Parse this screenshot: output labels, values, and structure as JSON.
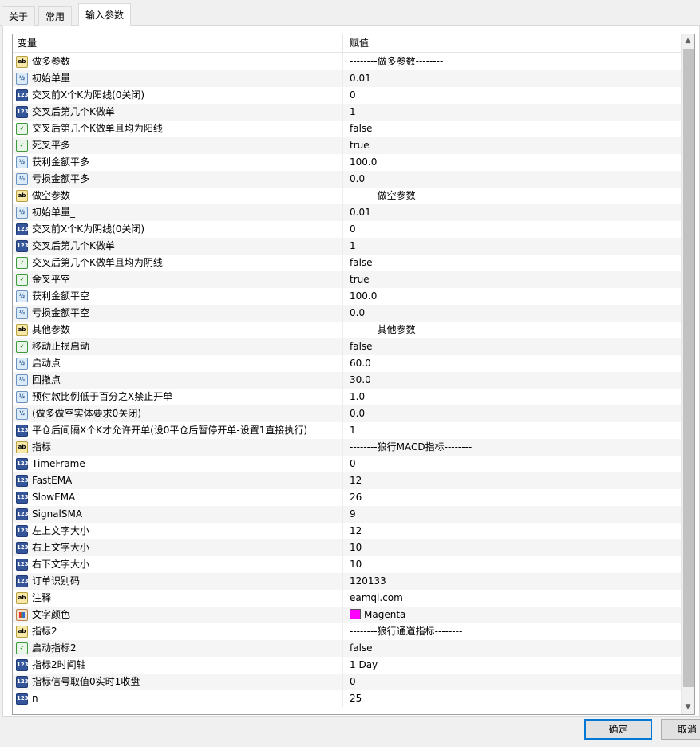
{
  "tabs": [
    {
      "label": "关于",
      "active": false
    },
    {
      "label": "常用",
      "active": false
    },
    {
      "label": "输入参数",
      "active": true
    }
  ],
  "columns": {
    "variable": "变量",
    "value": "赋值"
  },
  "rows": [
    {
      "type": "str",
      "icon": "ab",
      "name": "做多参数",
      "value": "--------做多参数--------"
    },
    {
      "type": "dbl",
      "icon": "½",
      "name": "初始单量",
      "value": "0.01"
    },
    {
      "type": "int",
      "icon": "123",
      "name": "交叉前X个K为阳线(0关闭)",
      "value": "0"
    },
    {
      "type": "int",
      "icon": "123",
      "name": "交叉后第几个K做单",
      "value": "1"
    },
    {
      "type": "bool",
      "icon": "✓",
      "name": "交叉后第几个K做单且均为阳线",
      "value": "false"
    },
    {
      "type": "bool",
      "icon": "✓",
      "name": "死叉平多",
      "value": "true"
    },
    {
      "type": "dbl",
      "icon": "½",
      "name": "获利金额平多",
      "value": "100.0"
    },
    {
      "type": "dbl",
      "icon": "½",
      "name": "亏损金额平多",
      "value": "0.0"
    },
    {
      "type": "str",
      "icon": "ab",
      "name": "做空参数",
      "value": "--------做空参数--------"
    },
    {
      "type": "dbl",
      "icon": "½",
      "name": "初始单量_",
      "value": "0.01"
    },
    {
      "type": "int",
      "icon": "123",
      "name": "交叉前X个K为阴线(0关闭)",
      "value": "0"
    },
    {
      "type": "int",
      "icon": "123",
      "name": "交叉后第几个K做单_",
      "value": "1"
    },
    {
      "type": "bool",
      "icon": "✓",
      "name": "交叉后第几个K做单且均为阴线",
      "value": "false"
    },
    {
      "type": "bool",
      "icon": "✓",
      "name": "金叉平空",
      "value": "true"
    },
    {
      "type": "dbl",
      "icon": "½",
      "name": "获利金额平空",
      "value": "100.0"
    },
    {
      "type": "dbl",
      "icon": "½",
      "name": "亏损金额平空",
      "value": "0.0"
    },
    {
      "type": "str",
      "icon": "ab",
      "name": "其他参数",
      "value": "--------其他参数--------"
    },
    {
      "type": "bool",
      "icon": "✓",
      "name": "移动止损启动",
      "value": "false"
    },
    {
      "type": "dbl",
      "icon": "½",
      "name": "启动点",
      "value": "60.0"
    },
    {
      "type": "dbl",
      "icon": "½",
      "name": "回撤点",
      "value": "30.0"
    },
    {
      "type": "dbl",
      "icon": "½",
      "name": "预付款比例低于百分之X禁止开单",
      "value": "1.0"
    },
    {
      "type": "dbl",
      "icon": "½",
      "name": "(做多做空实体要求0关闭)",
      "value": "0.0"
    },
    {
      "type": "int",
      "icon": "123",
      "name": "平仓后间隔X个K才允许开单(设0平仓后暂停开单-设置1直接执行)",
      "value": "1"
    },
    {
      "type": "str",
      "icon": "ab",
      "name": "指标",
      "value": "--------狼行MACD指标--------"
    },
    {
      "type": "int",
      "icon": "123",
      "name": "TimeFrame",
      "value": "0"
    },
    {
      "type": "int",
      "icon": "123",
      "name": "FastEMA",
      "value": "12"
    },
    {
      "type": "int",
      "icon": "123",
      "name": "SlowEMA",
      "value": "26"
    },
    {
      "type": "int",
      "icon": "123",
      "name": "SignalSMA",
      "value": "9"
    },
    {
      "type": "int",
      "icon": "123",
      "name": "左上文字大小",
      "value": "12"
    },
    {
      "type": "int",
      "icon": "123",
      "name": "右上文字大小",
      "value": "10"
    },
    {
      "type": "int",
      "icon": "123",
      "name": "右下文字大小",
      "value": "10"
    },
    {
      "type": "int",
      "icon": "123",
      "name": "订单识别码",
      "value": "120133"
    },
    {
      "type": "str",
      "icon": "ab",
      "name": "注释",
      "value": "eamql.com"
    },
    {
      "type": "col",
      "icon": "",
      "name": "文字颜色",
      "value": "Magenta",
      "swatch": "#ff00ff"
    },
    {
      "type": "str",
      "icon": "ab",
      "name": "指标2",
      "value": "--------狼行通道指标--------"
    },
    {
      "type": "bool",
      "icon": "✓",
      "name": "启动指标2",
      "value": "false"
    },
    {
      "type": "int",
      "icon": "123",
      "name": "指标2时间轴",
      "value": "1 Day"
    },
    {
      "type": "int",
      "icon": "123",
      "name": "指标信号取值0实时1收盘",
      "value": "0"
    },
    {
      "type": "int",
      "icon": "123",
      "name": "n",
      "value": "25"
    }
  ],
  "buttons": {
    "ok": "确定",
    "cancel": "取消"
  }
}
